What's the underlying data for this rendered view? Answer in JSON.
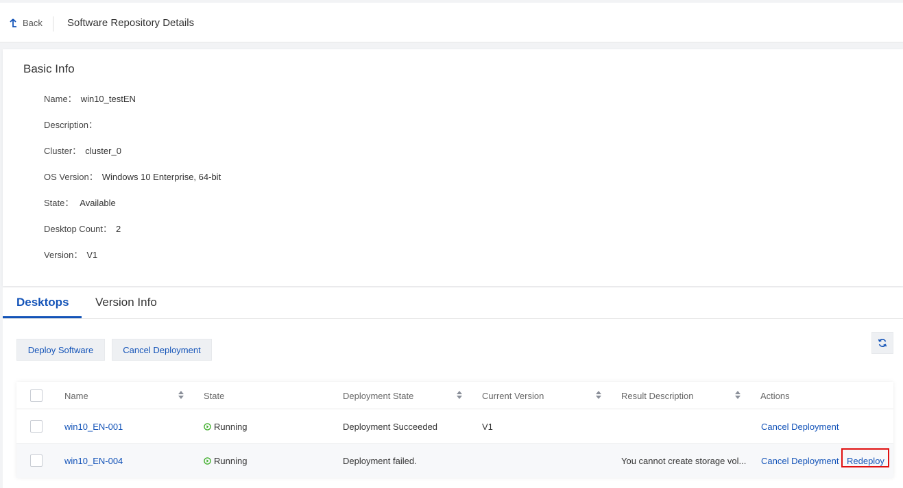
{
  "header": {
    "back_label": "Back",
    "page_title": "Software Repository Details"
  },
  "basic_info": {
    "title": "Basic Info",
    "fields": [
      {
        "label": "Name：",
        "value": "win10_testEN"
      },
      {
        "label": "Description：",
        "value": ""
      },
      {
        "label": "Cluster：",
        "value": "cluster_0"
      },
      {
        "label": "OS Version：",
        "value": "Windows 10 Enterprise, 64-bit"
      },
      {
        "label": "State：",
        "value": " Available"
      },
      {
        "label": "Desktop Count：",
        "value": "2"
      },
      {
        "label": "Version：",
        "value": "V1"
      }
    ]
  },
  "tabs": [
    {
      "label": "Desktops",
      "active": true
    },
    {
      "label": "Version Info",
      "active": false
    }
  ],
  "toolbar": {
    "deploy_label": "Deploy Software",
    "cancel_label": "Cancel Deployment",
    "refresh_icon": "refresh-icon"
  },
  "table": {
    "columns": [
      "Name",
      "State",
      "Deployment State",
      "Current Version",
      "Result Description",
      "Actions"
    ],
    "rows": [
      {
        "name": "win10_EN-001",
        "state": "Running",
        "deployment_state": "Deployment Succeeded",
        "current_version": "V1",
        "result_description": "",
        "actions": [
          "Cancel Deployment"
        ]
      },
      {
        "name": "win10_EN-004",
        "state": "Running",
        "deployment_state": "Deployment failed.",
        "current_version": "",
        "result_description": "You cannot create storage vol...",
        "actions": [
          "Cancel Deployment",
          "Redeploy"
        ]
      }
    ]
  },
  "colors": {
    "accent": "#1353b8",
    "running": "#3fae2a",
    "highlight": "#e01010"
  }
}
